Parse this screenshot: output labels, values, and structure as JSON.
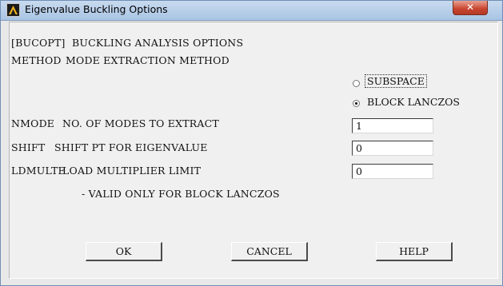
{
  "window": {
    "title": "Eigenvalue Buckling Options",
    "close_glyph": "✕"
  },
  "header": {
    "line1": "[BUCOPT]  BUCKLING ANALYSIS OPTIONS",
    "method_key": "METHOD",
    "method_desc": "MODE EXTRACTION METHOD"
  },
  "method_options": [
    {
      "label": "SUBSPACE",
      "selected": false
    },
    {
      "label": "BLOCK LANCZOS",
      "selected": true
    }
  ],
  "fields": {
    "nmode": {
      "key": "NMODE",
      "desc": "NO. OF MODES TO EXTRACT",
      "value": "1"
    },
    "shift": {
      "key": "SHIFT",
      "desc": "SHIFT PT FOR EIGENVALUE",
      "value": "0"
    },
    "ldmulte": {
      "key": "LDMULTE",
      "desc": "LOAD MULTIPLIER LIMIT",
      "value": "0"
    }
  },
  "note": "- VALID ONLY FOR BLOCK LANCZOS",
  "buttons": {
    "ok": "OK",
    "cancel": "CANCEL",
    "help": "HELP"
  }
}
